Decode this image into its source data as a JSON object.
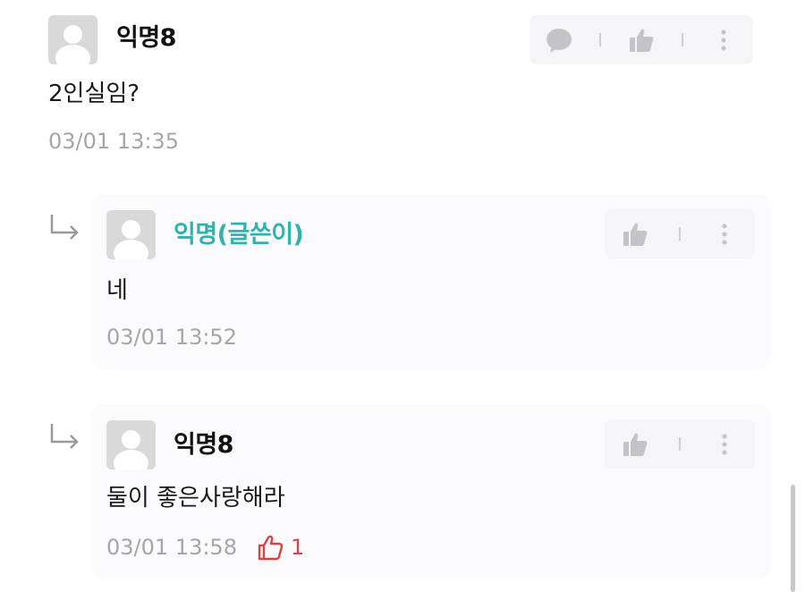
{
  "comments": [
    {
      "author": "익명8",
      "text": "2인실임?",
      "time": "03/01 13:35",
      "actions": [
        "reply-icon",
        "thumbs-up-icon",
        "more-vertical-icon"
      ]
    }
  ],
  "replies": [
    {
      "author": "익명(글쓴이)",
      "text": "네",
      "time": "03/01 13:52",
      "actions": [
        "thumbs-up-icon",
        "more-vertical-icon"
      ]
    },
    {
      "author": "익명8",
      "text": "둘이 좋은사랑해라",
      "time": "03/01 13:58",
      "like_count": "1",
      "actions": [
        "thumbs-up-icon",
        "more-vertical-icon"
      ]
    }
  ],
  "colors": {
    "author_highlight": "#2eb3ad",
    "like_red": "#d64545",
    "meta_gray": "#a6a6a6",
    "icon_gray": "#c4c4c8"
  }
}
